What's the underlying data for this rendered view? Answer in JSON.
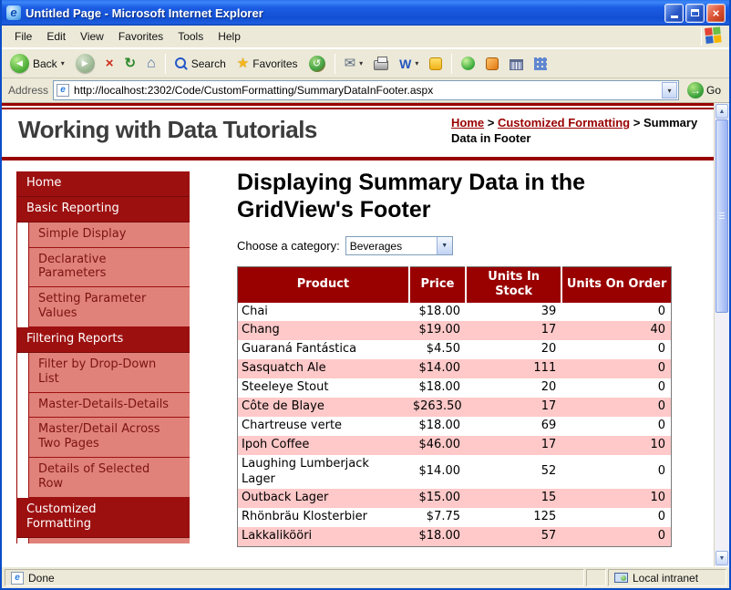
{
  "window": {
    "title": "Untitled Page - Microsoft Internet Explorer"
  },
  "menu": {
    "items": [
      "File",
      "Edit",
      "View",
      "Favorites",
      "Tools",
      "Help"
    ]
  },
  "toolbar": {
    "back_label": "Back",
    "search_label": "Search",
    "favorites_label": "Favorites"
  },
  "address_bar": {
    "label": "Address",
    "url": "http://localhost:2302/Code/CustomFormatting/SummaryDataInFooter.aspx",
    "go_label": "Go"
  },
  "status_bar": {
    "left": "Done",
    "right": "Local intranet"
  },
  "icons": {
    "back_arrow": "◀",
    "forward_arrow": "▶",
    "stop_glyph": "×",
    "refresh_glyph": "↻",
    "home_glyph": "⌂",
    "star_glyph": "★",
    "history_glyph": "↺",
    "mail_glyph": "✉",
    "word_glyph": "W",
    "caret_down": "▾",
    "go_arrow": "→",
    "scroll_up": "▲",
    "scroll_down": "▼",
    "close_glyph": "×",
    "ie_glyph": "e",
    "select_arrow": "▼"
  },
  "page": {
    "site_title": "Working with Data Tutorials",
    "breadcrumb": {
      "separator": ">",
      "items": [
        {
          "label": "Home",
          "type": "link"
        },
        {
          "label": "Customized Formatting",
          "type": "link"
        },
        {
          "label": "Summary Data in Footer",
          "type": "current"
        }
      ]
    },
    "heading": "Displaying Summary Data in the GridView's Footer",
    "category": {
      "label": "Choose a category:",
      "selected": "Beverages"
    },
    "sidebar": {
      "items": [
        {
          "label": "Home",
          "level": 0
        },
        {
          "label": "Basic Reporting",
          "level": 0
        },
        {
          "label": "Simple Display",
          "level": 1
        },
        {
          "label": "Declarative Parameters",
          "level": 1
        },
        {
          "label": "Setting Parameter Values",
          "level": 1
        },
        {
          "label": "Filtering Reports",
          "level": 0
        },
        {
          "label": "Filter by Drop-Down List",
          "level": 1
        },
        {
          "label": "Master-Details-Details",
          "level": 1
        },
        {
          "label": "Master/Detail Across Two Pages",
          "level": 1
        },
        {
          "label": "Details of Selected Row",
          "level": 1
        },
        {
          "label": "Customized Formatting",
          "level": 0
        }
      ]
    },
    "products_table": {
      "headers": [
        "Product",
        "Price",
        "Units In Stock",
        "Units On Order"
      ],
      "rows": [
        [
          "Chai",
          "$18.00",
          "39",
          "0"
        ],
        [
          "Chang",
          "$19.00",
          "17",
          "40"
        ],
        [
          "Guaraná Fantástica",
          "$4.50",
          "20",
          "0"
        ],
        [
          "Sasquatch Ale",
          "$14.00",
          "111",
          "0"
        ],
        [
          "Steeleye Stout",
          "$18.00",
          "20",
          "0"
        ],
        [
          "Côte de Blaye",
          "$263.50",
          "17",
          "0"
        ],
        [
          "Chartreuse verte",
          "$18.00",
          "69",
          "0"
        ],
        [
          "Ipoh Coffee",
          "$46.00",
          "17",
          "10"
        ],
        [
          "Laughing Lumberjack Lager",
          "$14.00",
          "52",
          "0"
        ],
        [
          "Outback Lager",
          "$15.00",
          "15",
          "10"
        ],
        [
          "Rhönbräu Klosterbier",
          "$7.75",
          "125",
          "0"
        ],
        [
          "Lakkalikööri",
          "$18.00",
          "57",
          "0"
        ]
      ]
    }
  },
  "colors": {
    "maroon": "#990000",
    "nav_top": "#9d1010",
    "nav_sub": "#e0827a",
    "row_pink": "#ffc9c9",
    "titlebar_blue": "#1c5ce4",
    "toolbar_tan": "#ece9d8"
  }
}
